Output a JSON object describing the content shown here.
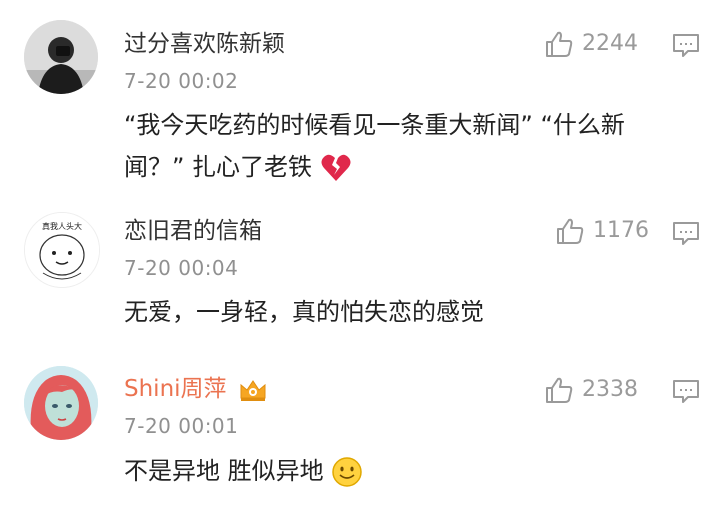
{
  "comments": [
    {
      "username": "过分喜欢陈新颖",
      "time": "7-20 00:02",
      "likes": "2244",
      "text": "“我今天吃药的时候看见一条重大新闻” “什么新闻？” 扎心了老铁",
      "avatar_icon": "avatar-dark-figure",
      "trail_icon": "broken-heart-icon"
    },
    {
      "username": "恋旧君的信箱",
      "time": "7-20 00:04",
      "likes": "1176",
      "text": "无爱，一身轻，真的怕失恋的感觉",
      "avatar_icon": "avatar-cartoon-face",
      "avatar_caption": "真我人头大"
    },
    {
      "username": "Shini周萍",
      "time": "7-20 00:01",
      "likes": "2338",
      "text": "不是异地 胜似异地",
      "avatar_icon": "avatar-illustrated-girl",
      "trail_icon": "smile-emoji-icon",
      "badge_icon": "vip-crown-icon"
    }
  ],
  "colors": {
    "vip_name": "#eb7350",
    "meta": "#909090",
    "icon": "#9a9a9a"
  }
}
